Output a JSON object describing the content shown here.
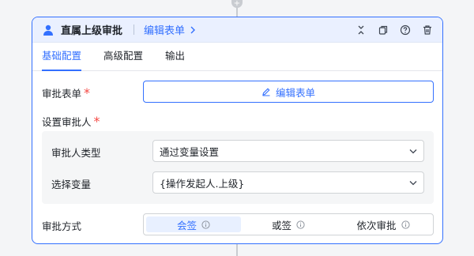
{
  "node": {
    "title": "直属上级审批",
    "edit_link": "编辑表单"
  },
  "header_icons": [
    "collapse-icon",
    "copy-icon",
    "help-icon",
    "delete-icon"
  ],
  "tabs": [
    {
      "label": "基础配置",
      "active": true
    },
    {
      "label": "高级配置",
      "active": false
    },
    {
      "label": "输出",
      "active": false
    }
  ],
  "approval_form": {
    "label": "审批表单",
    "required_mark": "*",
    "button_label": "编辑表单"
  },
  "approver": {
    "label": "设置审批人",
    "required_mark": "*",
    "type_label": "审批人类型",
    "type_value": "通过变量设置",
    "variable_label": "选择变量",
    "variable_value": "{操作发起人.上级}"
  },
  "approval_mode": {
    "label": "审批方式",
    "options": [
      {
        "label": "会签",
        "active": true
      },
      {
        "label": "或签",
        "active": false
      },
      {
        "label": "依次审批",
        "active": false
      }
    ]
  },
  "colors": {
    "accent": "#3370ff",
    "header_bg": "#eaf0ff",
    "required": "#f54a45"
  }
}
